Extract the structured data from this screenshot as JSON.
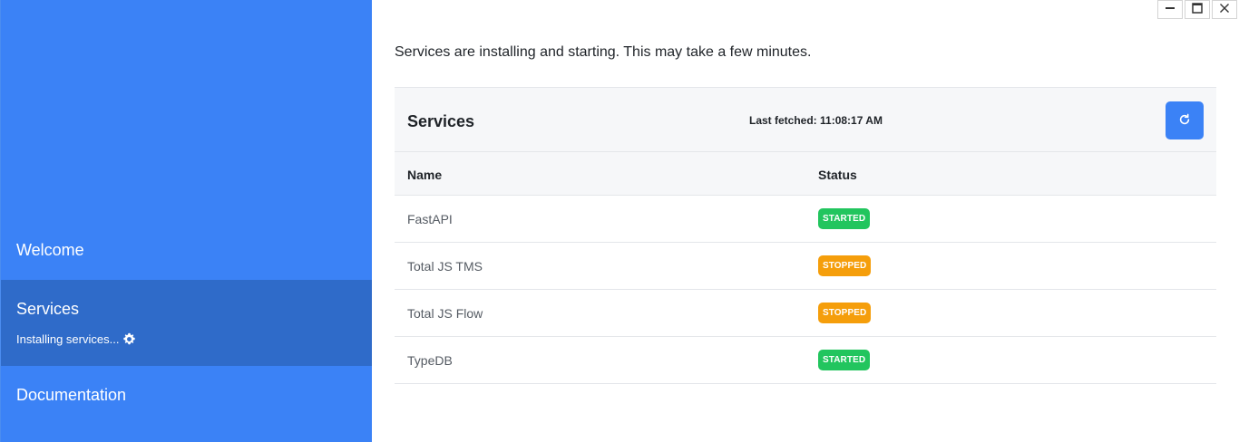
{
  "window": {
    "controls": [
      "minimize",
      "maximize",
      "close"
    ]
  },
  "sidebar": {
    "items": [
      {
        "label": "Welcome"
      },
      {
        "label": "Services",
        "sub": "Installing services...",
        "active": true
      },
      {
        "label": "Documentation"
      }
    ]
  },
  "main": {
    "intro": "Services are installing and starting. This may take a few minutes.",
    "panel": {
      "title": "Services",
      "last_fetched": "Last fetched: 11:08:17 AM",
      "refresh_icon": "refresh-icon"
    },
    "table": {
      "columns": [
        "Name",
        "Status"
      ],
      "rows": [
        {
          "name": "FastAPI",
          "status": "STARTED"
        },
        {
          "name": "Total JS TMS",
          "status": "STOPPED"
        },
        {
          "name": "Total JS Flow",
          "status": "STOPPED"
        },
        {
          "name": "TypeDB",
          "status": "STARTED"
        }
      ]
    }
  },
  "colors": {
    "sidebar": "#3b82f6",
    "sidebar_active": "#2f6bc9",
    "started": "#22c55e",
    "stopped": "#f59e0b",
    "accent": "#3b82f6"
  }
}
